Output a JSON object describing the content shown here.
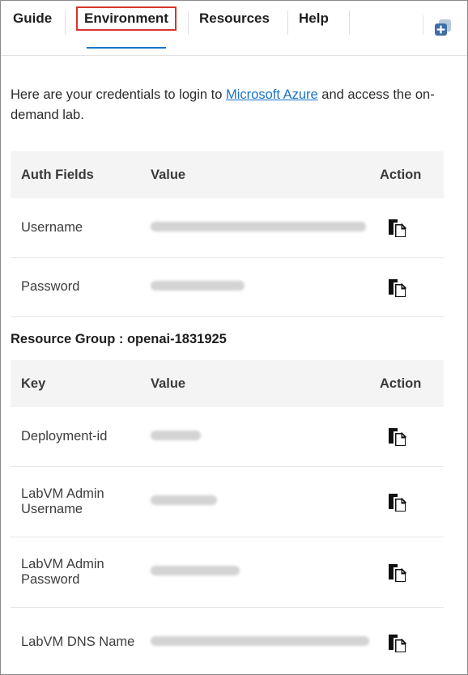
{
  "tabs": [
    {
      "label": "Guide"
    },
    {
      "label": "Environment",
      "active": true
    },
    {
      "label": "Resources"
    },
    {
      "label": "Help"
    }
  ],
  "intro": {
    "before": "Here are your credentials to login to ",
    "link": "Microsoft Azure",
    "after": " and access the on-demand lab."
  },
  "credentials": {
    "headers": {
      "field": "Auth Fields",
      "value": "Value",
      "action": "Action"
    },
    "rows": [
      {
        "label": "Username"
      },
      {
        "label": "Password"
      }
    ]
  },
  "resource_group": {
    "label": "Resource Group : openai-1831925",
    "headers": {
      "field": "Key",
      "value": "Value",
      "action": "Action"
    },
    "rows": [
      {
        "label": "Deployment-id"
      },
      {
        "label": "LabVM Admin Username"
      },
      {
        "label": "LabVM Admin Password"
      },
      {
        "label": "LabVM DNS Name"
      }
    ]
  },
  "colors": {
    "accent": "#1a73c9",
    "highlight": "#d9342b"
  }
}
